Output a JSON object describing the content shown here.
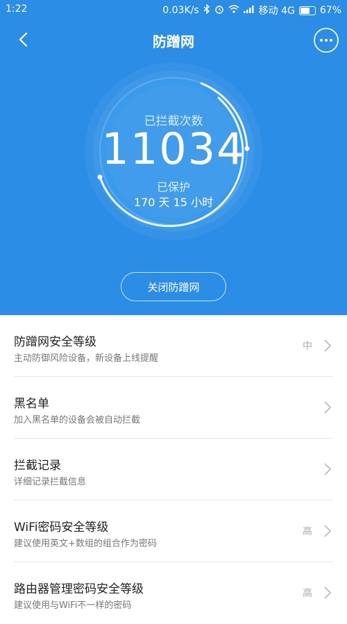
{
  "status_bar": {
    "time": "1:22",
    "speed": "0.03K/s",
    "carrier": "移动 4G",
    "battery": "67%"
  },
  "header": {
    "title": "防蹭网"
  },
  "stats": {
    "blocked_label": "已拦截次数",
    "blocked_count": "11034",
    "protected_label": "已保护",
    "protected_duration": "170 天 15 小时"
  },
  "close_button_label": "关闭防蹭网",
  "settings": [
    {
      "title": "防蹭网安全等级",
      "subtitle": "主动防御风险设备，新设备上线提醒",
      "value": "中"
    },
    {
      "title": "黑名单",
      "subtitle": "加入黑名单的设备会被自动拦截",
      "value": ""
    },
    {
      "title": "拦截记录",
      "subtitle": "详细记录拦截信息",
      "value": ""
    },
    {
      "title": "WiFi密码安全等级",
      "subtitle": "建议使用英文+数组的组合作为密码",
      "value": "高"
    },
    {
      "title": "路由器管理密码安全等级",
      "subtitle": "建议使用与WiFi不一样的密码",
      "value": "高"
    }
  ],
  "colors": {
    "accent": "#2b8de6"
  }
}
